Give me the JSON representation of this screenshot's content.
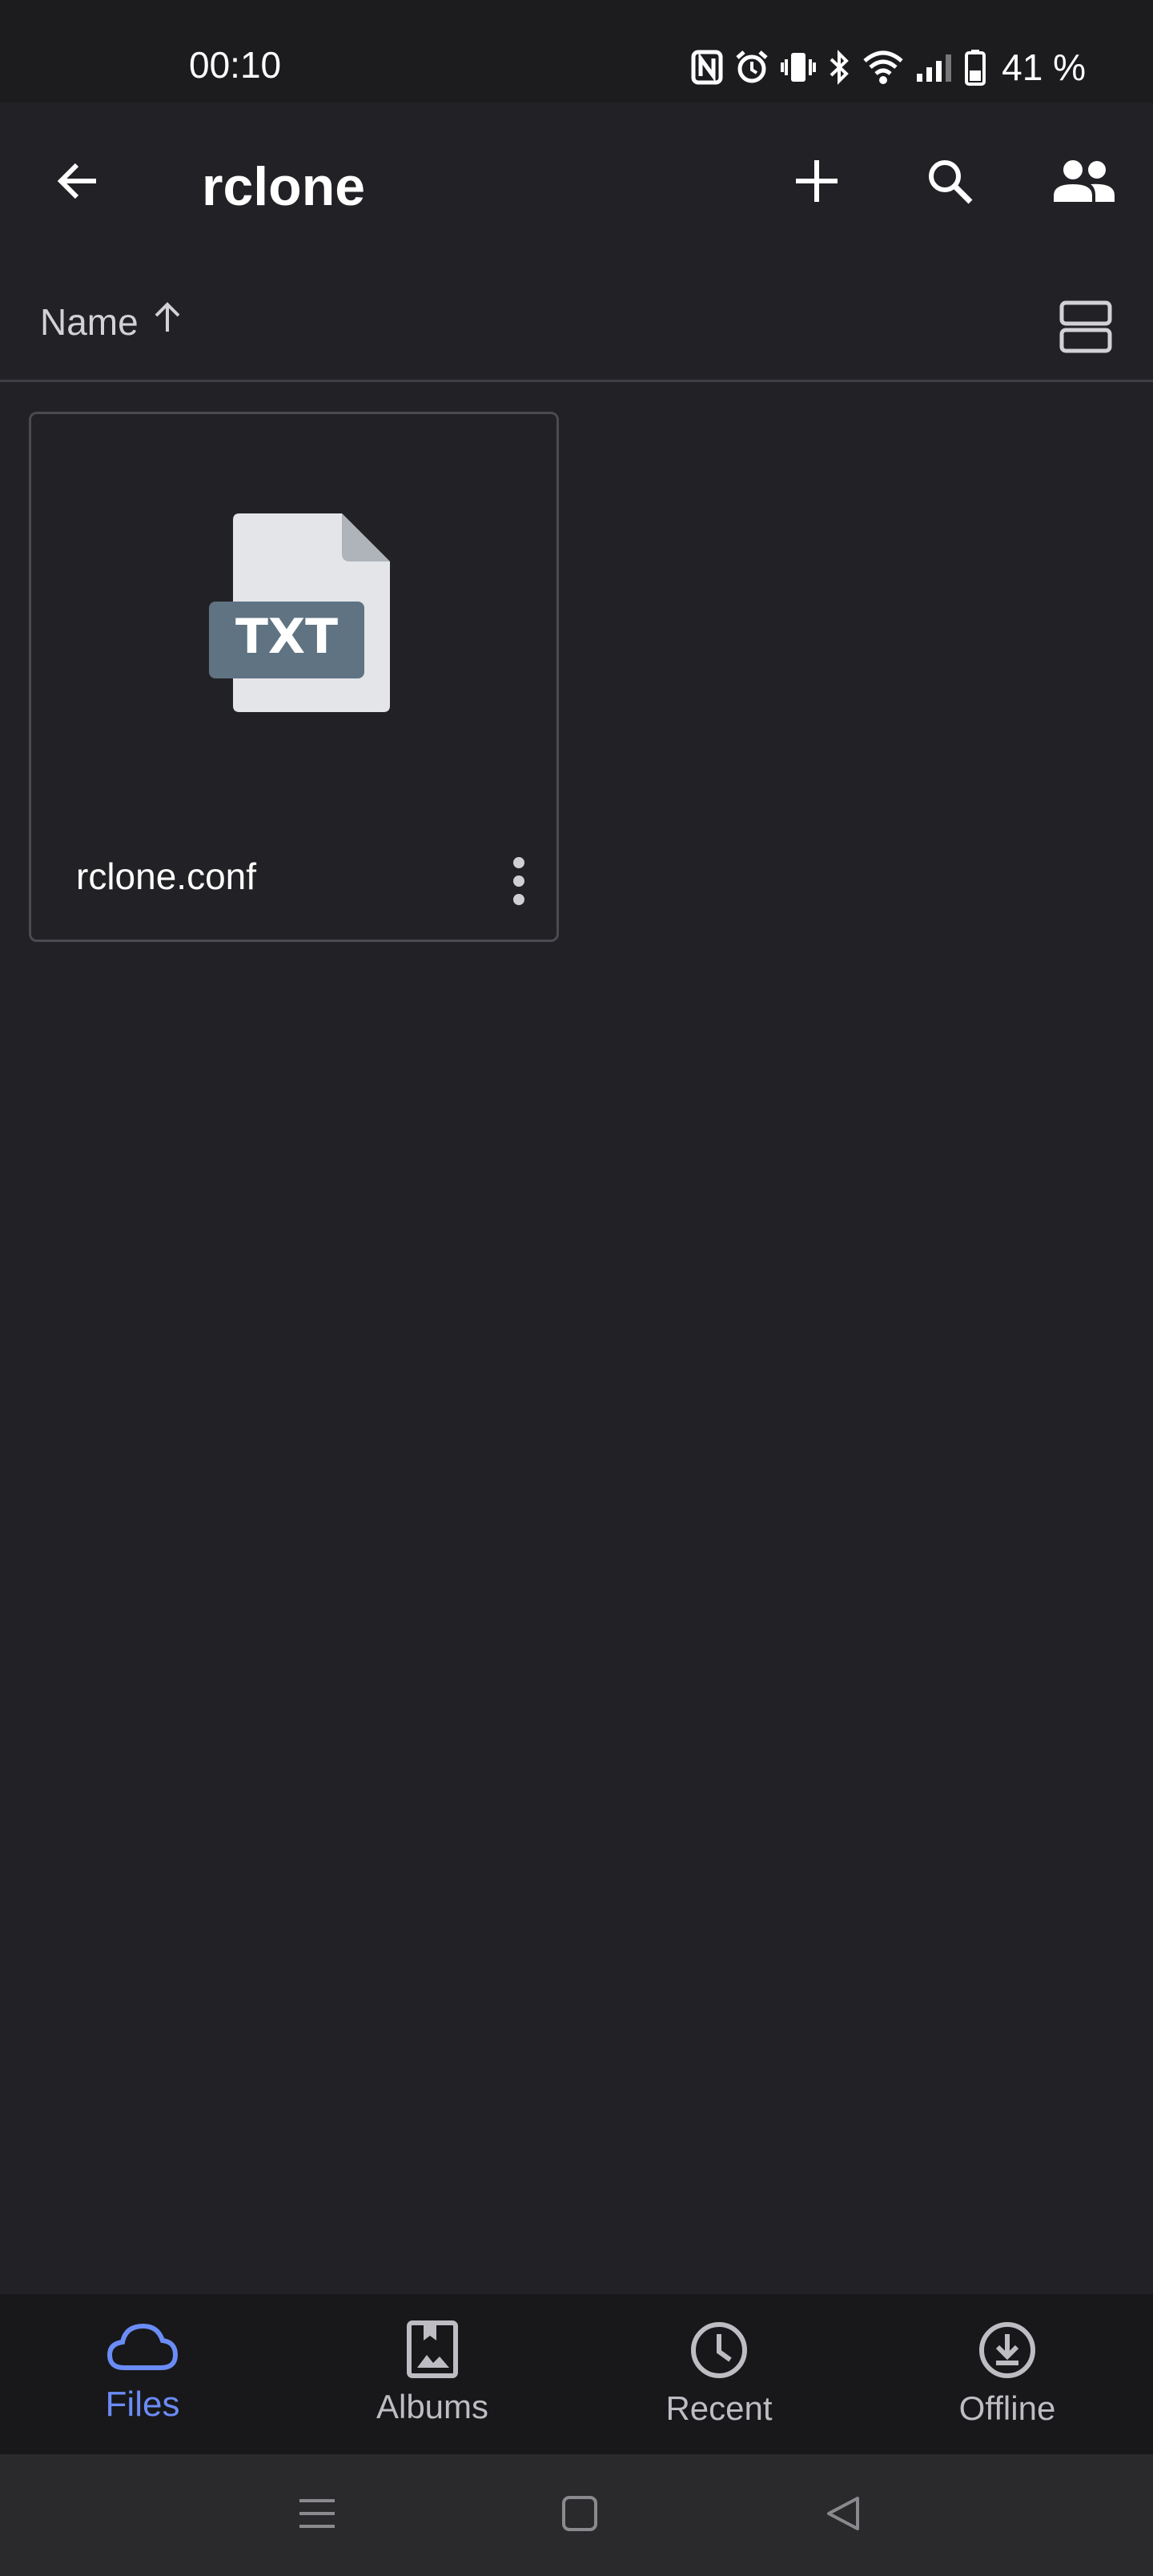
{
  "status_bar": {
    "time": "00:10",
    "battery": "41 %",
    "icons": [
      "nfc-icon",
      "alarm-icon",
      "vibrate-icon",
      "bluetooth-icon",
      "wifi-icon",
      "signal-icon",
      "battery-icon"
    ]
  },
  "app_bar": {
    "title": "rclone",
    "back_icon": "arrow-back-icon",
    "actions": [
      "add-icon",
      "search-icon",
      "people-icon"
    ]
  },
  "sort": {
    "label": "Name",
    "direction": "ascending",
    "view_icon": "list-view-icon"
  },
  "files": [
    {
      "name": "rclone.conf",
      "type_badge": "TXT",
      "menu_icon": "more-vert-icon"
    }
  ],
  "bottom_nav": {
    "items": [
      {
        "label": "Files",
        "icon": "cloud-icon",
        "active": true
      },
      {
        "label": "Albums",
        "icon": "album-icon",
        "active": false
      },
      {
        "label": "Recent",
        "icon": "clock-icon",
        "active": false
      },
      {
        "label": "Offline",
        "icon": "download-icon",
        "active": false
      }
    ]
  },
  "system_nav": [
    "menu-icon",
    "home-icon",
    "back-triangle-icon"
  ],
  "colors": {
    "background": "#222226",
    "accent": "#6b8cf6",
    "badge": "#5f7382"
  }
}
